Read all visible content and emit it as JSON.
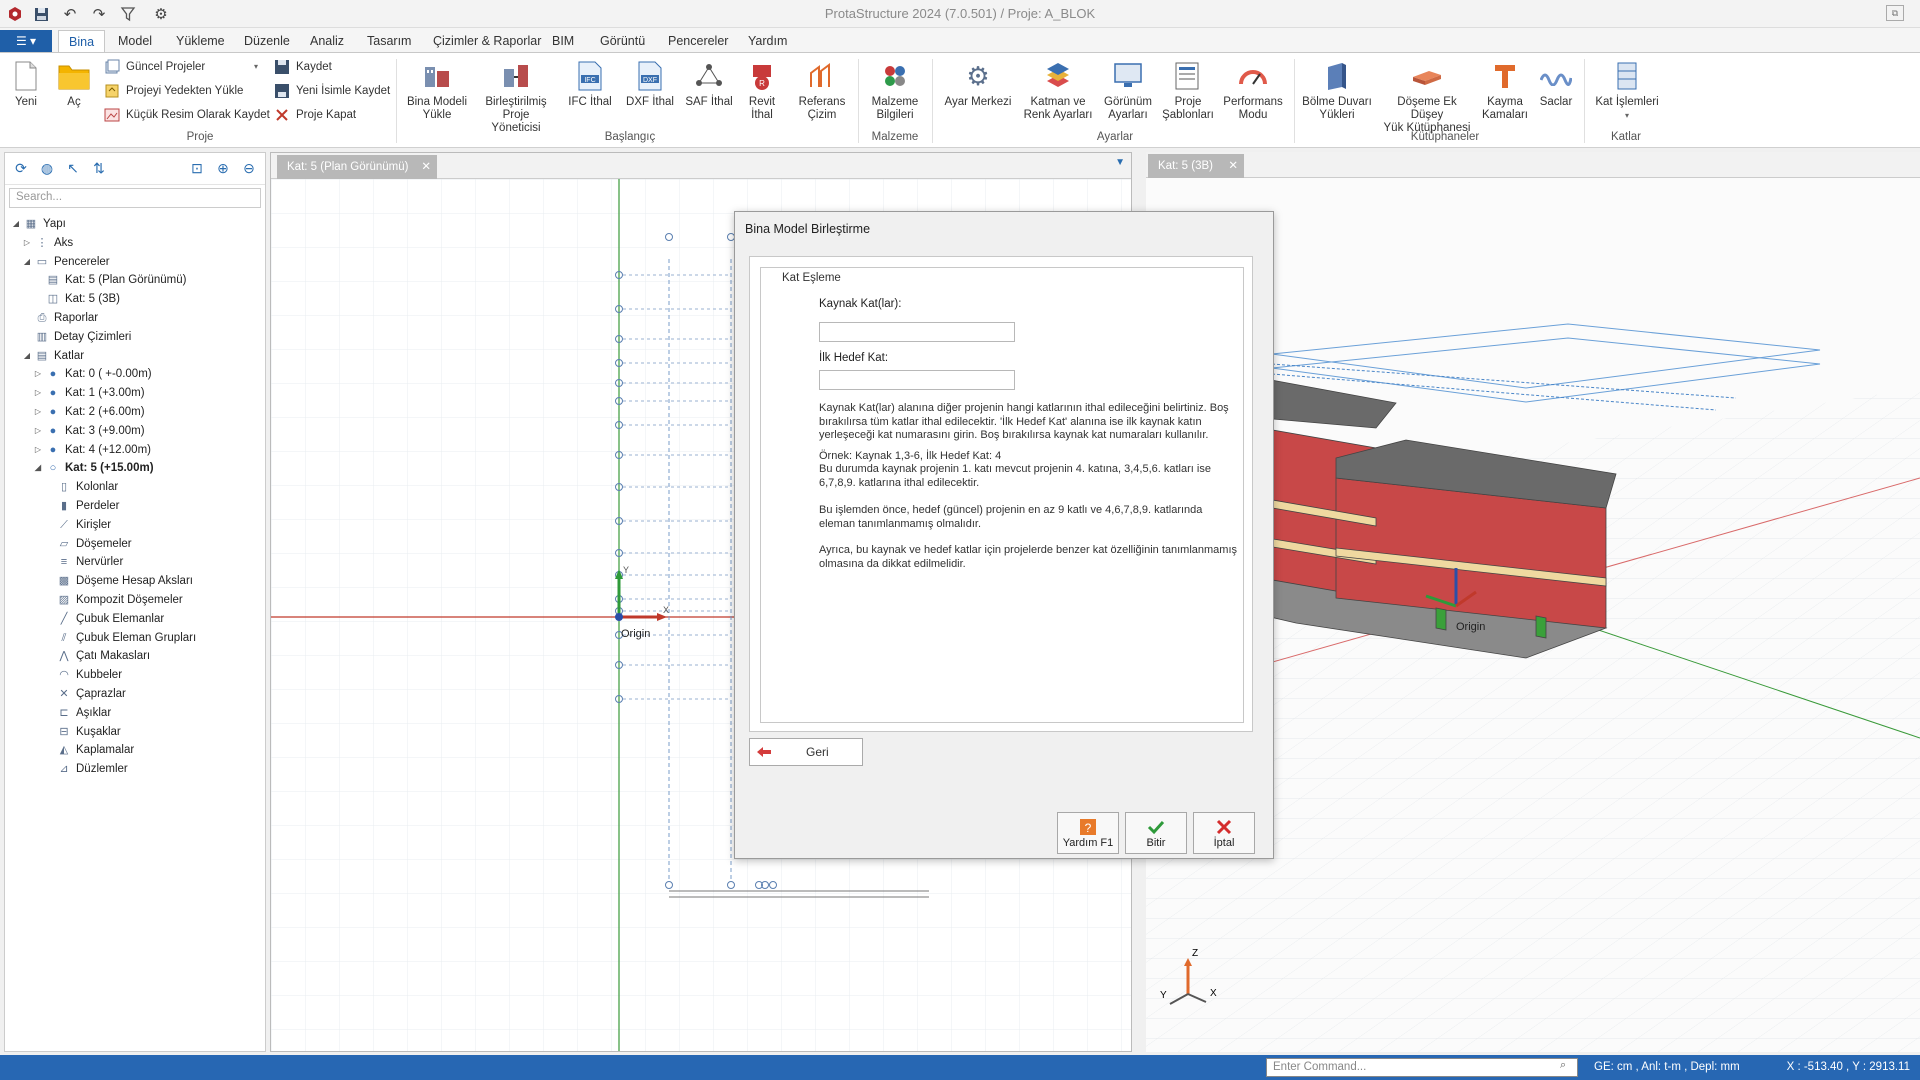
{
  "window": {
    "title": "ProtaStructure 2024 (7.0.501) / Proje: A_BLOK"
  },
  "menu": {
    "tabs": [
      "Bina",
      "Model",
      "Yükleme",
      "Düzenle",
      "Analiz",
      "Tasarım",
      "Çizimler & Raporlar",
      "BIM",
      "Görüntü",
      "Pencereler",
      "Yardım"
    ],
    "active": "Bina"
  },
  "ribbon": {
    "proje": {
      "group_label": "Proje",
      "yeni": "Yeni",
      "ac": "Aç",
      "guncel_projeler": "Güncel Projeler",
      "projeyi_yedekten_yukle": "Projeyi Yedekten Yükle",
      "kucuk_resim": "Küçük Resim Olarak Kaydet",
      "kaydet": "Kaydet",
      "yeni_isimle_kaydet": "Yeni İsimle Kaydet",
      "proje_kapat": "Proje Kapat"
    },
    "baslangic": {
      "group_label": "Başlangıç",
      "bina_modeli_yukle": [
        "Bina Modeli",
        "Yükle"
      ],
      "birlestirilmis": [
        "Birleştirilmiş",
        "Proje Yöneticisi"
      ],
      "ifc_ithal": "IFC İthal",
      "dxf_ithal": "DXF İthal",
      "saf_ithal": "SAF İthal",
      "revit_ithal": [
        "Revit",
        "İthal"
      ],
      "referans_cizim": [
        "Referans",
        "Çizim"
      ]
    },
    "malzeme": {
      "group_label": "Malzeme",
      "malzeme_bilgileri": [
        "Malzeme",
        "Bilgileri"
      ]
    },
    "ayarlar": {
      "group_label": "Ayarlar",
      "ayar_merkezi": "Ayar Merkezi",
      "katman": [
        "Katman ve",
        "Renk Ayarları"
      ],
      "gorunum": [
        "Görünüm",
        "Ayarları"
      ],
      "proje_sablonlari": [
        "Proje",
        "Şablonları"
      ],
      "performans": [
        "Performans",
        "Modu"
      ]
    },
    "kutuphaneler": {
      "group_label": "Kütüphaneler",
      "bolme_duvari": [
        "Bölme Duvarı",
        "Yükleri"
      ],
      "doseme_ek": [
        "Döşeme Ek Düşey",
        "Yük Kütüphanesi"
      ],
      "kayma_kamalari": [
        "Kayma",
        "Kamaları"
      ],
      "saclar": "Saclar"
    },
    "katlar": {
      "group_label": "Katlar",
      "kat_islemleri": "Kat İşlemleri"
    }
  },
  "left_panel": {
    "search_placeholder": "Search...",
    "tree": [
      {
        "label": "Yapı",
        "level": 0,
        "exp": "◢",
        "icon": "structure-icon"
      },
      {
        "label": "Aks",
        "level": 1,
        "exp": "▷",
        "icon": "axis-icon"
      },
      {
        "label": "Pencereler",
        "level": 1,
        "exp": "◢",
        "icon": "windows-icon"
      },
      {
        "label": "Kat: 5 (Plan Görünümü)",
        "level": 2,
        "exp": "",
        "icon": "plan-view-icon"
      },
      {
        "label": "Kat: 5 (3B)",
        "level": 2,
        "exp": "",
        "icon": "3d-view-icon"
      },
      {
        "label": "Raporlar",
        "level": 1,
        "exp": "",
        "icon": "printer-icon"
      },
      {
        "label": "Detay Çizimleri",
        "level": 1,
        "exp": "",
        "icon": "drawings-icon"
      },
      {
        "label": "Katlar",
        "level": 1,
        "exp": "◢",
        "icon": "storeys-icon"
      },
      {
        "label": "Kat: 0 ( +-0.00m)",
        "level": 2,
        "exp": "▷",
        "icon": "storey-dot-icon"
      },
      {
        "label": "Kat: 1 (+3.00m)",
        "level": 2,
        "exp": "▷",
        "icon": "storey-dot-icon"
      },
      {
        "label": "Kat: 2 (+6.00m)",
        "level": 2,
        "exp": "▷",
        "icon": "storey-dot-icon"
      },
      {
        "label": "Kat: 3 (+9.00m)",
        "level": 2,
        "exp": "▷",
        "icon": "storey-dot-icon"
      },
      {
        "label": "Kat: 4 (+12.00m)",
        "level": 2,
        "exp": "▷",
        "icon": "storey-dot-icon"
      },
      {
        "label": "Kat: 5 (+15.00m)",
        "level": 2,
        "exp": "◢",
        "icon": "storey-ring-icon",
        "bold": true
      },
      {
        "label": "Kolonlar",
        "level": 3,
        "exp": "",
        "icon": "column-icon"
      },
      {
        "label": "Perdeler",
        "level": 3,
        "exp": "",
        "icon": "wall-icon"
      },
      {
        "label": "Kirişler",
        "level": 3,
        "exp": "",
        "icon": "beam-icon"
      },
      {
        "label": "Döşemeler",
        "level": 3,
        "exp": "",
        "icon": "slab-icon"
      },
      {
        "label": "Nervürler",
        "level": 3,
        "exp": "",
        "icon": "rib-icon"
      },
      {
        "label": "Döşeme Hesap Aksları",
        "level": 3,
        "exp": "",
        "icon": "slab-axis-icon"
      },
      {
        "label": "Kompozit Döşemeler",
        "level": 3,
        "exp": "",
        "icon": "composite-slab-icon"
      },
      {
        "label": "Çubuk Elemanlar",
        "level": 3,
        "exp": "",
        "icon": "bar-element-icon"
      },
      {
        "label": "Çubuk Eleman Grupları",
        "level": 3,
        "exp": "",
        "icon": "bar-group-icon"
      },
      {
        "label": "Çatı Makasları",
        "level": 3,
        "exp": "",
        "icon": "truss-icon"
      },
      {
        "label": "Kubbeler",
        "level": 3,
        "exp": "",
        "icon": "dome-icon"
      },
      {
        "label": "Çaprazlar",
        "level": 3,
        "exp": "",
        "icon": "brace-icon"
      },
      {
        "label": "Aşıklar",
        "level": 3,
        "exp": "",
        "icon": "purlin-icon"
      },
      {
        "label": "Kuşaklar",
        "level": 3,
        "exp": "",
        "icon": "girt-icon"
      },
      {
        "label": "Kaplamalar",
        "level": 3,
        "exp": "",
        "icon": "cladding-icon"
      },
      {
        "label": "Düzlemler",
        "level": 3,
        "exp": "",
        "icon": "plane-icon"
      }
    ]
  },
  "views": {
    "plan_tab": "Kat: 5 (Plan Görünümü)",
    "view3d_tab": "Kat: 5 (3B)",
    "origin_label": "Origin",
    "axis_x": "X",
    "axis_y": "Y",
    "axis_z": "Z"
  },
  "dialog": {
    "title": "Bina Model Birleştirme",
    "group_label": "Kat Eşleme",
    "source_label": "Kaynak Kat(lar):",
    "source_value": "",
    "target_label": "İlk Hedef Kat:",
    "target_value": "",
    "para1": "Kaynak Kat(lar) alanına diğer projenin hangi katlarının ithal edileceğini belirtiniz. Boş bırakılırsa tüm katlar ithal edilecektir. 'İlk Hedef Kat' alanına ise ilk kaynak katın yerleşeceği kat numarasını girin. Boş bırakılırsa kaynak kat numaraları kullanılır.",
    "para2_1": "Örnek: Kaynak 1,3-6, İlk Hedef Kat: 4",
    "para2_2": "Bu durumda kaynak projenin 1. katı mevcut projenin 4. katına, 3,4,5,6. katları ise 6,7,8,9. katlarına ithal edilecektir.",
    "para3": "Bu işlemden önce, hedef (güncel) projenin en az 9 katlı ve 4,6,7,8,9. katlarında eleman tanımlanmamış olmalıdır.",
    "para4": "Ayrıca, bu kaynak ve hedef katlar için projelerde benzer kat özelliğinin tanımlanmamış olmasına da dikkat edilmelidir.",
    "back_button": "Geri",
    "help_button": "Yardım  F1",
    "finish_button": "Bitir",
    "cancel_button": "İptal"
  },
  "statusbar": {
    "command_placeholder": "Enter Command...",
    "units": "GE: cm , Anl: t-m , Depl: mm",
    "coords": "X : -513.40 , Y : 2913.11"
  }
}
